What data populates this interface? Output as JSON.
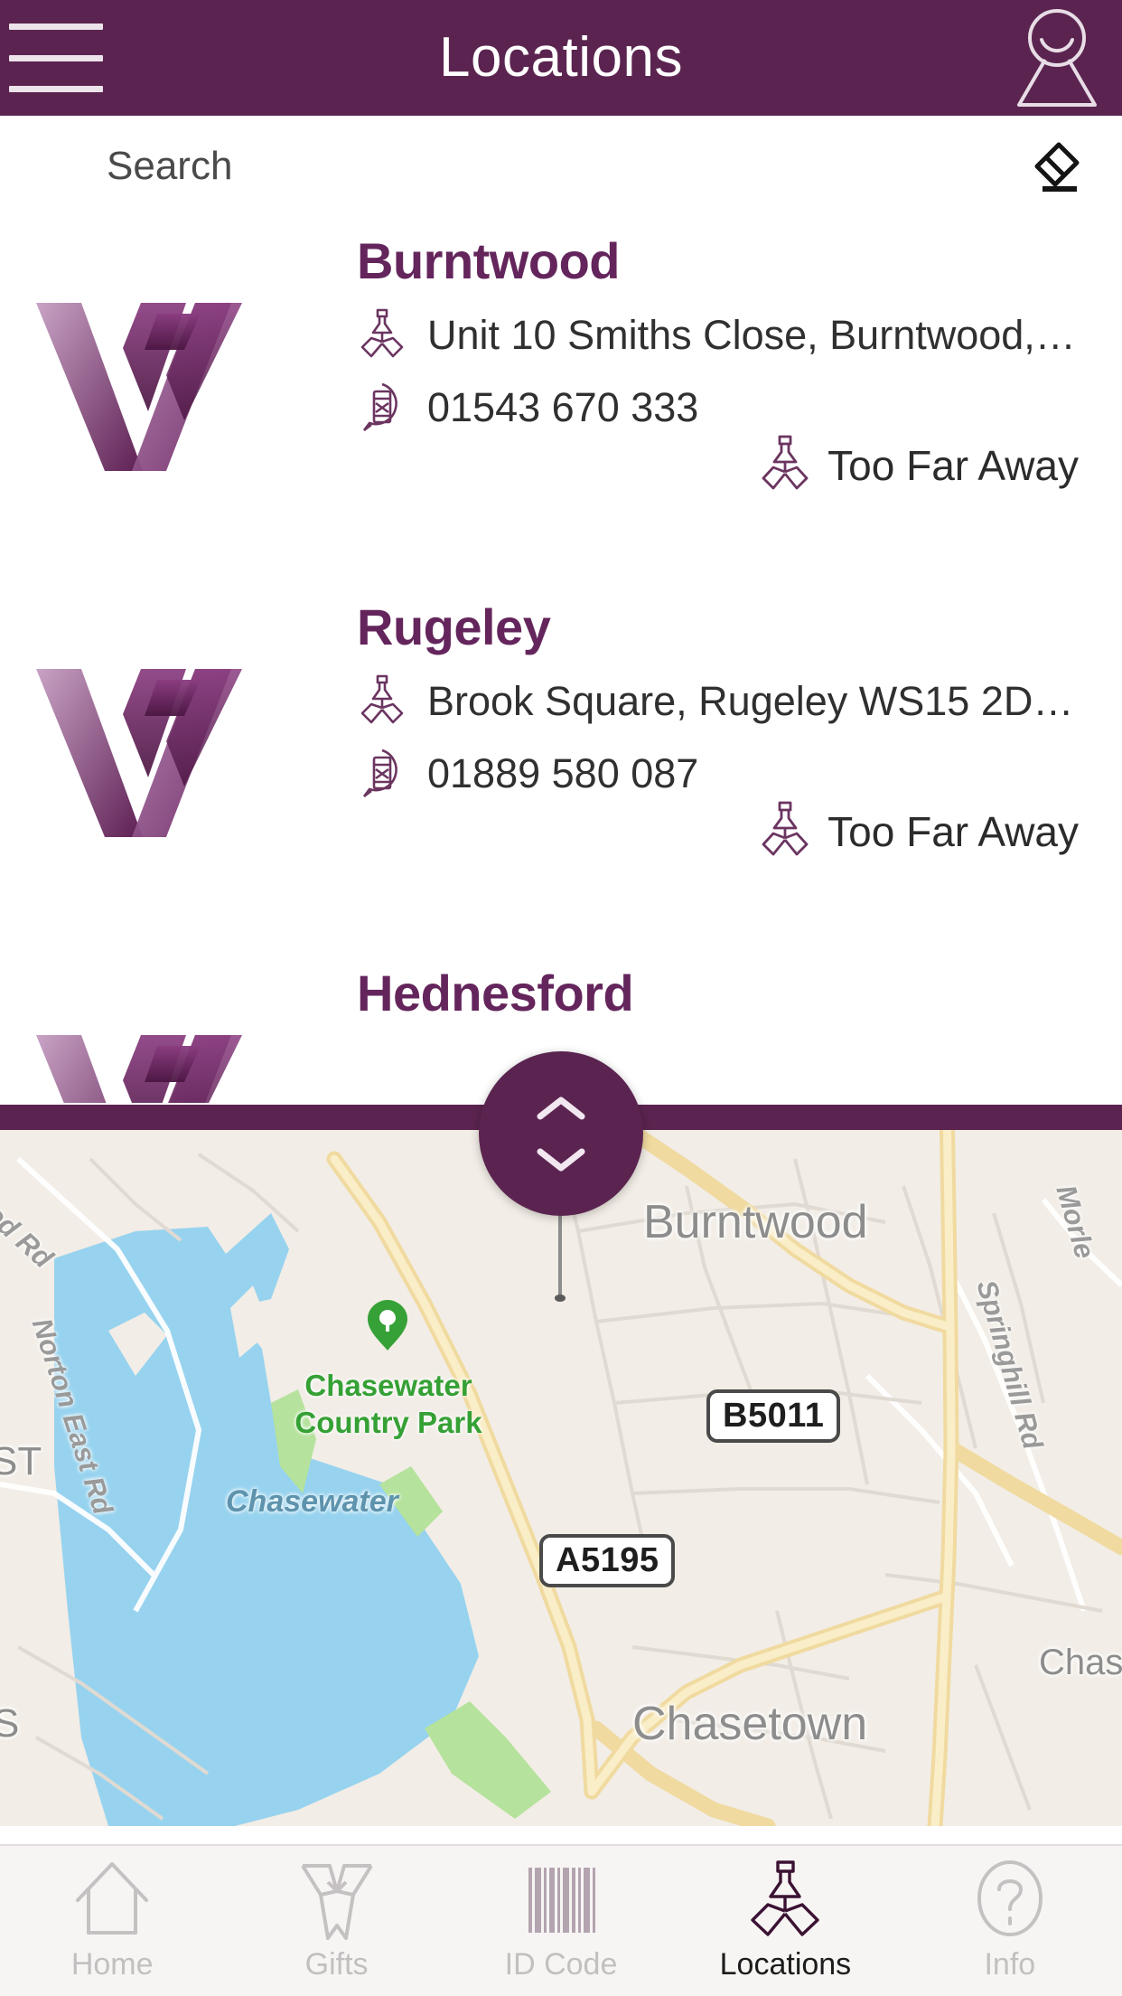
{
  "header": {
    "title": "Locations",
    "menu_icon": "hamburger-menu-icon",
    "profile_icon": "profile-avatar-icon"
  },
  "search": {
    "placeholder": "Search",
    "value": "",
    "clear_icon": "eraser-icon"
  },
  "brand": {
    "accent": "#5b2450",
    "logo_dark": "#5d1f52",
    "logo_light": "#a36ba0",
    "title_color": "#64255c"
  },
  "locations": [
    {
      "name": "Burntwood",
      "address": "Unit 10 Smiths Close, Burntwood,…",
      "phone": "01543 670 333",
      "distance": "Too Far Away",
      "address_icon": "map-pin-icon",
      "phone_icon": "phone-bubble-icon",
      "distance_icon": "map-pin-icon",
      "logo_icon": "w-logo"
    },
    {
      "name": "Rugeley",
      "address": "Brook Square, Rugeley WS15 2DR…",
      "phone": "01889 580 087",
      "distance": "Too Far Away",
      "address_icon": "map-pin-icon",
      "phone_icon": "phone-bubble-icon",
      "distance_icon": "map-pin-icon",
      "logo_icon": "w-logo"
    },
    {
      "name": "Hednesford",
      "address": "",
      "phone": "",
      "distance": "",
      "address_icon": "map-pin-icon",
      "phone_icon": "phone-bubble-icon",
      "distance_icon": "map-pin-icon",
      "logo_icon": "w-logo"
    }
  ],
  "scroll_fab": {
    "up_icon": "chevron-up-icon",
    "down_icon": "chevron-down-icon"
  },
  "map": {
    "labels": {
      "burntwood": "Burntwood",
      "chasetown": "Chasetown",
      "chase": "Chase",
      "chasewater_park_line1": "Chasewater",
      "chasewater_park_line2": "Country Park",
      "chasewater_lake": "Chasewater",
      "norton_east_rd": "Norton East Rd",
      "wood_rd": "ood Rd",
      "springhill_rd": "Springhill Rd",
      "morle": "Morle",
      "st_fragment": "ST",
      "s_fragment": "S"
    },
    "shields": [
      {
        "label": "B5011"
      },
      {
        "label": "A5195"
      }
    ],
    "colors": {
      "land": "#f2ede6",
      "water": "#97d3ef",
      "road_major": "#f7e39b",
      "road_minor": "#ffffff",
      "park": "#b8e3a0"
    }
  },
  "tabbar": {
    "items": [
      {
        "label": "Home",
        "icon": "home-arrow-icon",
        "active": false
      },
      {
        "label": "Gifts",
        "icon": "gift-bow-icon",
        "active": false
      },
      {
        "label": "ID Code",
        "icon": "barcode-icon",
        "active": false
      },
      {
        "label": "Locations",
        "icon": "map-pin-icon",
        "active": true
      },
      {
        "label": "Info",
        "icon": "question-mark-icon",
        "active": false
      }
    ]
  }
}
